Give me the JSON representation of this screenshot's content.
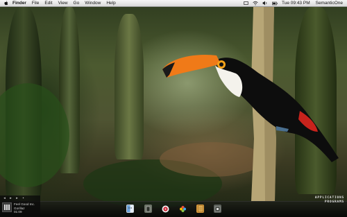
{
  "menubar": {
    "apple_icon": "apple-logo-icon",
    "items": [
      {
        "label": "Finder",
        "bold": true
      },
      {
        "label": "File"
      },
      {
        "label": "Edit"
      },
      {
        "label": "View"
      },
      {
        "label": "Go"
      },
      {
        "label": "Window"
      },
      {
        "label": "Help"
      }
    ],
    "status_icons": [
      "spotlight-menu-icon",
      "wifi-icon",
      "volume-icon",
      "battery-icon"
    ],
    "clock": "Tue 09:43 PM",
    "user": "SemanticOne"
  },
  "music_widget": {
    "controls": [
      "previous-icon",
      "play-icon",
      "next-icon",
      "menu-icon"
    ],
    "track": "Feel Good Inc.",
    "artist": "Gorillaz",
    "time": "01:09"
  },
  "dock": {
    "icons": [
      "finder-icon",
      "app-icon",
      "itunes-icon",
      "photos-icon",
      "notes-icon",
      "system-prefs-icon"
    ]
  },
  "brand": {
    "line1": "APPLICATIONS",
    "line2": "PROGRAMS"
  },
  "colors": {
    "menubar": "#e8e8e8",
    "beak": "#f07a18",
    "toucan_body": "#0d0d0d",
    "trunk": "#b7a676"
  }
}
